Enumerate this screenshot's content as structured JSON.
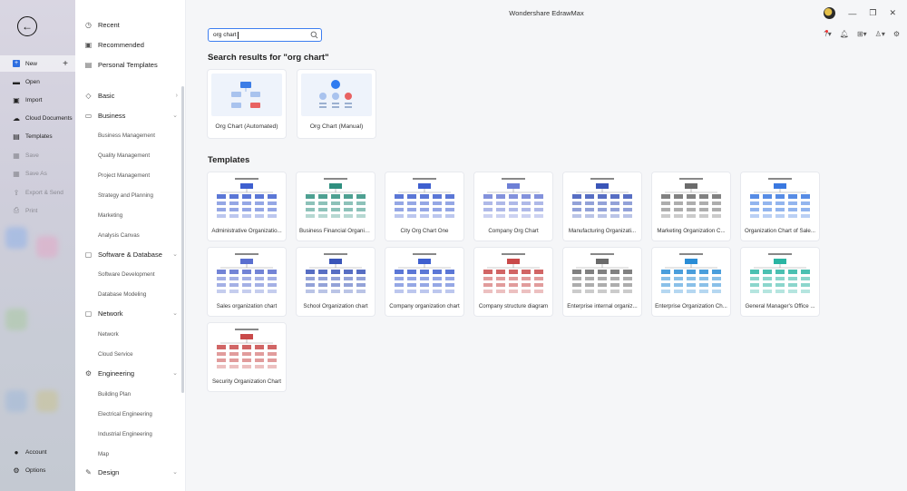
{
  "window": {
    "title": "Wondershare EdrawMax"
  },
  "rail": {
    "items": [
      {
        "label": "New",
        "icon": "new-icon"
      },
      {
        "label": "Open",
        "icon": "folder-icon"
      },
      {
        "label": "Import",
        "icon": "import-icon"
      },
      {
        "label": "Cloud Documents",
        "icon": "cloud-icon"
      },
      {
        "label": "Templates",
        "icon": "templates-icon"
      },
      {
        "label": "Save",
        "icon": "save-icon"
      },
      {
        "label": "Save As",
        "icon": "save-as-icon"
      },
      {
        "label": "Export & Send",
        "icon": "export-icon"
      },
      {
        "label": "Print",
        "icon": "print-icon"
      }
    ],
    "account": "Account",
    "options": "Options"
  },
  "sidebar": {
    "top": [
      {
        "label": "Recent",
        "icon": "clock-icon"
      },
      {
        "label": "Recommended",
        "icon": "recommended-icon"
      },
      {
        "label": "Personal Templates",
        "icon": "personal-templates-icon"
      }
    ],
    "categories": [
      {
        "label": "Basic",
        "icon": "basic-icon",
        "expanded": false,
        "children": []
      },
      {
        "label": "Business",
        "icon": "business-icon",
        "expanded": true,
        "children": [
          "Business Management",
          "Quality Management",
          "Project Management",
          "Strategy and Planning",
          "Marketing",
          "Analysis Canvas"
        ]
      },
      {
        "label": "Software & Database",
        "icon": "software-icon",
        "expanded": true,
        "children": [
          "Software Development",
          "Database Modeling"
        ]
      },
      {
        "label": "Network",
        "icon": "network-icon",
        "expanded": true,
        "children": [
          "Network",
          "Cloud Service"
        ]
      },
      {
        "label": "Engineering",
        "icon": "engineering-icon",
        "expanded": true,
        "children": [
          "Building Plan",
          "Electrical Engineering",
          "Industrial Engineering",
          "Map"
        ]
      },
      {
        "label": "Design",
        "icon": "design-icon",
        "expanded": true,
        "children": []
      }
    ]
  },
  "search": {
    "value": "org chart",
    "placeholder": ""
  },
  "results": {
    "title": "Search results for \"org chart\"",
    "cards": [
      {
        "label": "Org Chart (Automated)"
      },
      {
        "label": "Org Chart (Manual)"
      }
    ]
  },
  "templates": {
    "title": "Templates",
    "items": [
      "Administrative Organizatio...",
      "Business Financial Organiz...",
      "City Org Chart One",
      "Company Org Chart",
      "Manufacturing Organizati...",
      "Marketing Organization C...",
      "Organization Chart of Sale...",
      "Sales organization chart",
      "School Organization chart",
      "Company organization chart",
      "Company structure diagram",
      "Enterprise internal organiz...",
      "Enterprise Organization Ch...",
      "General Manager's Office ...",
      "Security Organization Chart"
    ]
  },
  "colors": {
    "accent": "#3d7ef0",
    "brand_blue": "#2f6fe0",
    "card_thumb": "#eef3fb"
  }
}
